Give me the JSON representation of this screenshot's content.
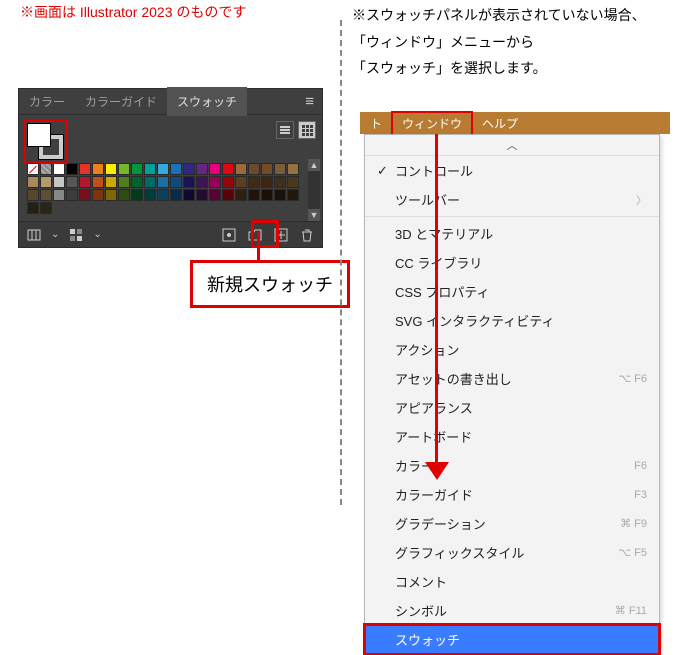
{
  "left_note": "※画面は Illustrator 2023 のものです",
  "panel": {
    "tabs": {
      "color": "カラー",
      "guide": "カラーガイド",
      "swatch": "スウォッチ"
    }
  },
  "swatch_colors_row1": [
    "#ffffff",
    "#000000"
  ],
  "swatch_palette": [
    "#ffffff",
    "#000000",
    "#e5332a",
    "#ef7f1a",
    "#ffed00",
    "#76b82a",
    "#009640",
    "#00a19a",
    "#36a9e1",
    "#1d71b8",
    "#312783",
    "#662483",
    "#e6007e",
    "#e30613",
    "#9d6b3a",
    "#6b4a2b",
    "#734b26",
    "#7a5b3a",
    "#94713f",
    "#a9885a",
    "#b59b6a",
    "#c6c6c6",
    "#575756",
    "#b2182b",
    "#c05018",
    "#cba900",
    "#4f7e1b",
    "#00642b",
    "#006a66",
    "#1c6ea4",
    "#104b7d",
    "#1b1454",
    "#3f1454",
    "#96005a",
    "#96040c",
    "#5d3e1e",
    "#3e2a15",
    "#3c2611",
    "#3e2e1a",
    "#4a381e",
    "#56472c",
    "#5e4e33",
    "#878787",
    "#3c3c3b",
    "#7a0f1c",
    "#7e340f",
    "#7e6800",
    "#2f4c10",
    "#003c19",
    "#003e3b",
    "#0f3f5e",
    "#082b47",
    "#0d0930",
    "#240b30",
    "#590035",
    "#590207",
    "#2e1f0f",
    "#1f150a",
    "#1a1007",
    "#1a130b",
    "#20180c",
    "#261f13",
    "#2c2416"
  ],
  "callout_label": "新規スウォッチ",
  "right_note_line1": "※スウォッチパネルが表示されていない場合、",
  "right_note_line2": "「ウィンドウ」メニューから",
  "right_note_line3": "「スウォッチ」を選択します。",
  "menubar": {
    "item1": "ト",
    "window": "ウィンドウ",
    "help": "ヘルプ"
  },
  "menu": {
    "control": "コントロール",
    "toolbar": "ツールバー",
    "threeD": "3D とマテリアル",
    "cclib": "CC ライブラリ",
    "css": "CSS プロパティ",
    "svg": "SVG インタラクティビティ",
    "action": "アクション",
    "asset": "アセットの書き出し",
    "appearance": "アピアランス",
    "artboard": "アートボード",
    "color": "カラー",
    "colorguide": "カラーガイド",
    "gradient": "グラデーション",
    "gstyle": "グラフィックスタイル",
    "comment": "コメント",
    "symbol": "シンボル",
    "swatch": "スウォッチ",
    "sc_asset": "⌥ F6",
    "sc_color": "F6",
    "sc_guide": "F3",
    "sc_grad": "⌘ F9",
    "sc_gstyle": "⌥ F5",
    "sc_symbol": "⌘ F11"
  }
}
